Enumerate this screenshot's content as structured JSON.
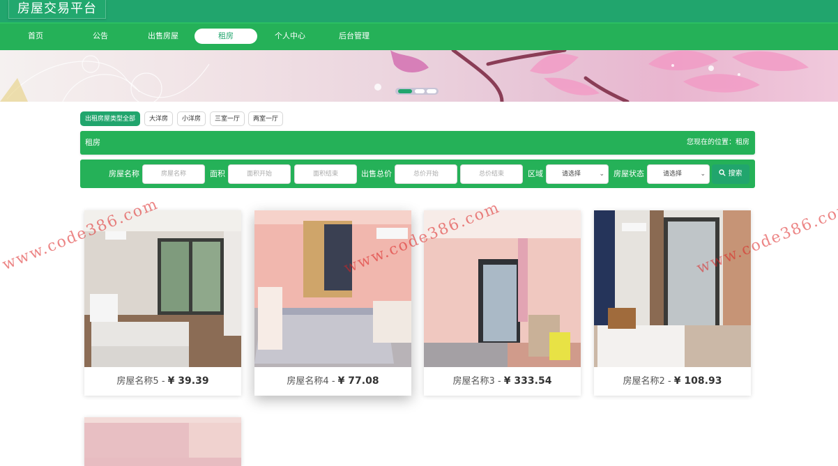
{
  "header": {
    "title": "房屋交易平台"
  },
  "nav": {
    "items": [
      {
        "label": "首页"
      },
      {
        "label": "公告"
      },
      {
        "label": "出售房屋"
      },
      {
        "label": "租房"
      },
      {
        "label": "个人中心"
      },
      {
        "label": "后台管理"
      }
    ],
    "active": "租房"
  },
  "banner": {
    "dots": 3,
    "active_dot": 1
  },
  "filters": {
    "tags": [
      {
        "label": "出租房屋类型全部"
      },
      {
        "label": "大洋房"
      },
      {
        "label": "小洋房"
      },
      {
        "label": "三室一厅"
      },
      {
        "label": "两室一厅"
      }
    ]
  },
  "location": {
    "section": "租房",
    "breadcrumb": "您现在的位置：租房"
  },
  "search": {
    "name_label": "房屋名称",
    "name_placeholder": "房屋名称",
    "area_label": "面积",
    "area_start_placeholder": "面积开始",
    "area_end_placeholder": "面积结束",
    "price_label": "出售总价",
    "price_start_placeholder": "总价开始",
    "price_end_placeholder": "总价结束",
    "region_label": "区域",
    "region_value": "请选择",
    "status_label": "房屋状态",
    "status_value": "请选择",
    "button": "搜索"
  },
  "listings": [
    {
      "name": "房屋名称5",
      "sep": " - ",
      "price": "¥ 39.39"
    },
    {
      "name": "房屋名称4",
      "sep": " - ",
      "price": "¥ 77.08"
    },
    {
      "name": "房屋名称3",
      "sep": " - ",
      "price": "¥ 333.54"
    },
    {
      "name": "房屋名称2",
      "sep": " - ",
      "price": "¥ 108.93"
    }
  ],
  "watermark": "www.code386.com",
  "colors": {
    "primary": "#21a56d",
    "nav": "#25b158",
    "watermark": "#d22222"
  },
  "icons": {
    "search": "magnifier-icon",
    "select": "chevron-down-icon"
  }
}
